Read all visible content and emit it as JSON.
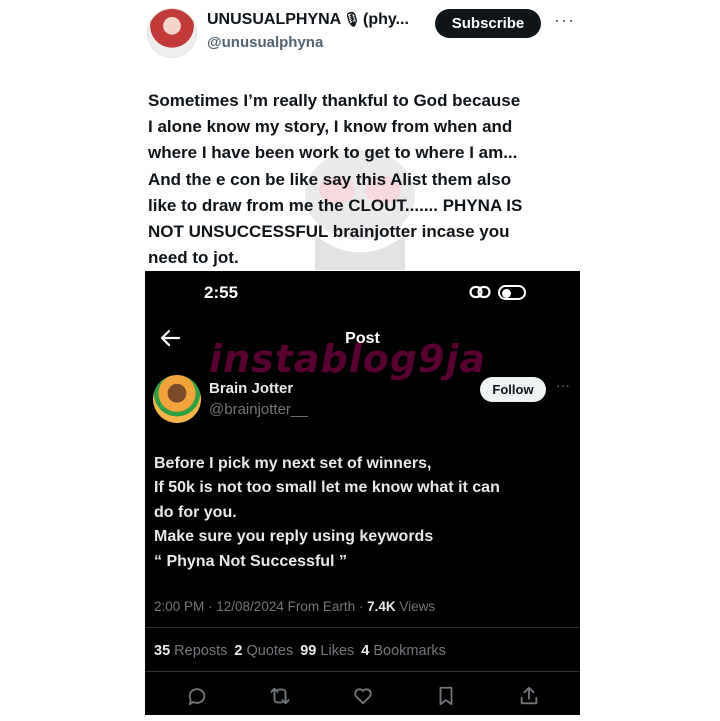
{
  "outer": {
    "display_name": "UNUSUALPHYNA",
    "name_suffix": "(phy...",
    "handle": "@unusualphyna",
    "subscribe_label": "Subscribe",
    "more_label": "···",
    "text_lines": [
      "Sometimes I’m really thankful to God because",
      "I alone know my story, I know from when and",
      "where I have been work to get to where I am...",
      "And the e con be like say this Alist them also",
      "like to draw from me the CLOUT....... PHYNA IS",
      "NOT UNSUCCESSFUL  brainjotter incase you",
      "need to jot."
    ]
  },
  "inner": {
    "status_time": "2:55",
    "page_title": "Post",
    "watermark": "instablog9ja",
    "display_name": "Brain Jotter",
    "handle": "@brainjotter__",
    "follow_label": "Follow",
    "more_label": "···",
    "text_lines": [
      "Before  I pick my next set of winners,",
      "If 50k is not too small let me know what it can",
      "do for you.",
      "Make sure you reply using keywords",
      "“ Phyna Not Successful ”"
    ],
    "meta": {
      "timestamp": "2:00 PM · 12/08/2024 From Earth · ",
      "views_count": "7.4K",
      "views_label": " Views"
    },
    "stats": {
      "reposts_count": "35",
      "reposts_label": "Reposts",
      "quotes_count": "2",
      "quotes_label": "Quotes",
      "likes_count": "99",
      "likes_label": "Likes",
      "bookmarks_count": "4",
      "bookmarks_label": "Bookmarks"
    },
    "action_icons": [
      "reply-icon",
      "repost-icon",
      "like-icon",
      "bookmark-icon",
      "share-icon"
    ]
  },
  "colors": {
    "subscribe_bg": "#0f1419",
    "dark_bg": "#000000",
    "muted_text": "#71767b",
    "watermark": "#e6007e"
  }
}
